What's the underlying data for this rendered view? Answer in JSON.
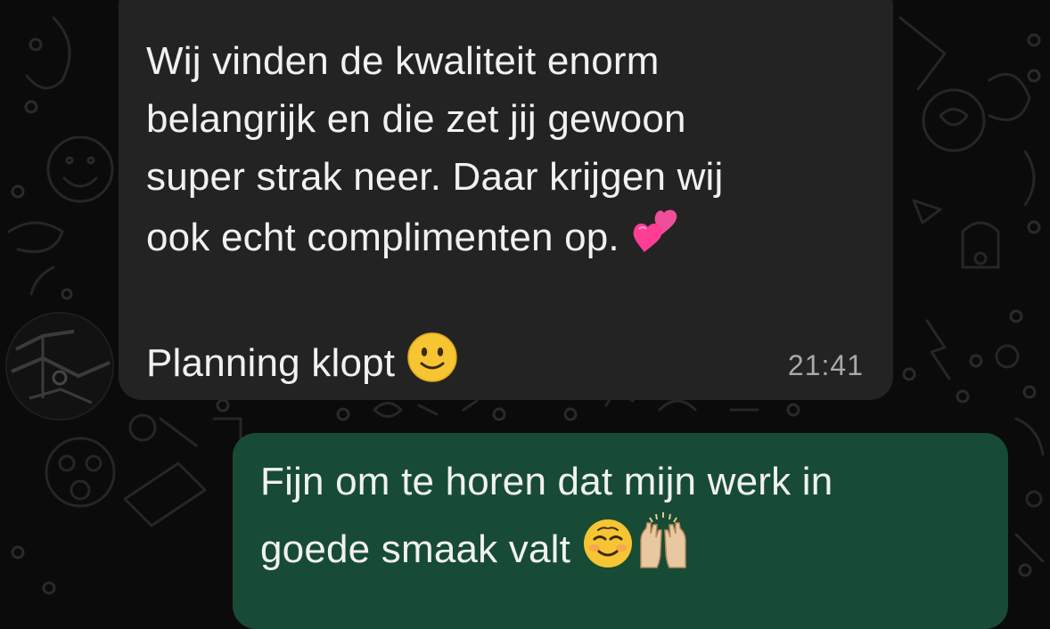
{
  "chat": {
    "incoming": {
      "text_lines": "Wij vinden de kwaliteit enorm\nbelangrijk en die zet jij gewoon\nsuper strak neer. Daar krijgen wij\nook echt complimenten op.",
      "emoji_1": "two-hearts",
      "text_line_2": "Planning klopt",
      "emoji_2": "slightly-smiling-face",
      "time": "21:41"
    },
    "outgoing": {
      "text_lines": "Fijn om te horen dat mijn werk in\ngoede smaak valt",
      "emoji_1": "smiling-face",
      "emoji_2": "raising-hands"
    }
  },
  "colors": {
    "background": "#0b0b0b",
    "incoming_bubble": "#232323",
    "outgoing_bubble": "#174b35",
    "text": "#f1f1f1",
    "timestamp": "#a9a9a9"
  }
}
